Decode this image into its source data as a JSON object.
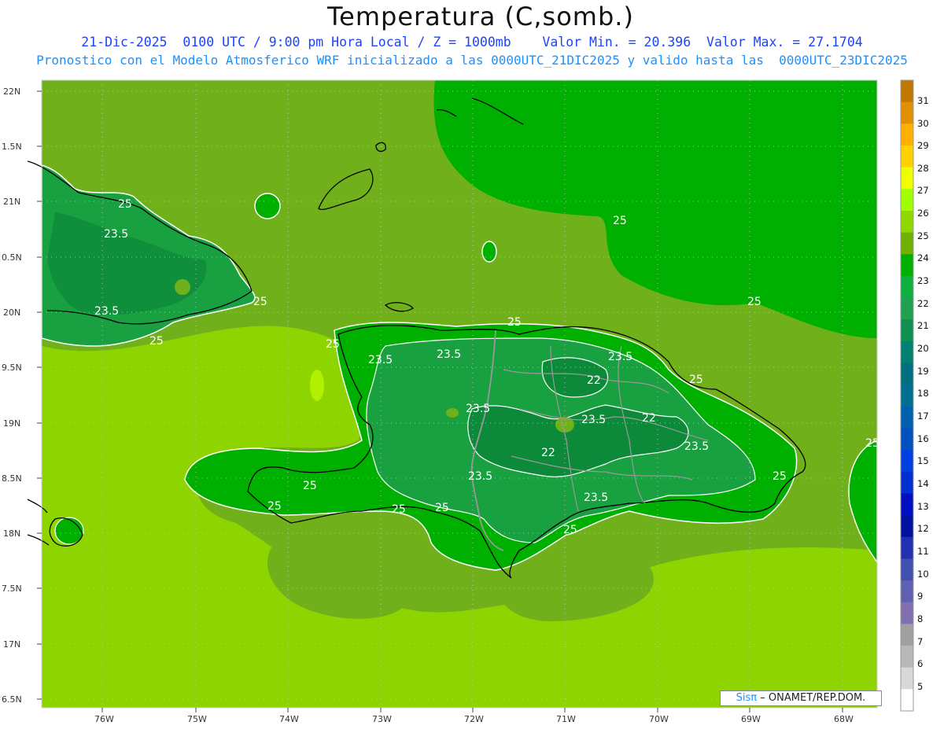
{
  "header": {
    "title": "Temperatura (C,somb.)",
    "line1": "21-Dic-2025  0100 UTC / 9:00 pm Hora Local / Z = 1000mb    Valor Min. = 20.396  Valor Max. = 27.1704",
    "line2": "Pronostico con el Modelo Atmosferico WRF inicializado a las 0000UTC_21DIC2025 y valido hasta las  0000UTC_23DIC2025"
  },
  "map": {
    "lat_labels": [
      "22N",
      "1.5N",
      "21N",
      "0.5N",
      "20N",
      "9.5N",
      "19N",
      "8.5N",
      "18N",
      "7.5N",
      "17N",
      "6.5N"
    ],
    "lon_labels": [
      "76W",
      "75W",
      "74W",
      "73W",
      "72W",
      "71W",
      "70W",
      "69W",
      "68W"
    ],
    "contour_labels": [
      "25",
      "23.5",
      "23.5",
      "25",
      "25",
      "25",
      "25",
      "23.5",
      "23.5",
      "25",
      "23.5",
      "22",
      "25",
      "22",
      "23.5",
      "23.5",
      "22",
      "23.5",
      "25",
      "25",
      "23.5",
      "25",
      "25",
      "25",
      "23.5",
      "25",
      "25"
    ],
    "colors": {
      "sea_warm": "#70b01a",
      "sea_warmer": "#8ed400",
      "land_24": "#00b000",
      "land_23": "#19a040",
      "land_22": "#0c8a3a",
      "contour_line": "#ffffff",
      "coast": "#000000",
      "border": "#999999"
    }
  },
  "colorbar": {
    "labels": [
      "31",
      "30",
      "29",
      "28",
      "27",
      "26",
      "25",
      "24",
      "23",
      "22",
      "21",
      "20",
      "19",
      "18",
      "17",
      "16",
      "15",
      "14",
      "13",
      "12",
      "11",
      "10",
      "9",
      "8",
      "7",
      "6",
      "5"
    ],
    "colors": [
      "#c07800",
      "#e09000",
      "#ffb000",
      "#ffd200",
      "#f0ff00",
      "#a0ff00",
      "#90d800",
      "#70b000",
      "#00b000",
      "#10b040",
      "#20a050",
      "#109050",
      "#008070",
      "#007080",
      "#007090",
      "#0060b0",
      "#0050c0",
      "#0040e0",
      "#0030d0",
      "#0010c0",
      "#0010a0",
      "#2030b0",
      "#4050b0",
      "#6060b0",
      "#8070b0",
      "#a0a0a0",
      "#b8b8b8",
      "#d8d8d8",
      "#ffffff"
    ]
  },
  "credit": {
    "sis": "Sisπ",
    "text": "– ONAMET/REP.DOM."
  }
}
